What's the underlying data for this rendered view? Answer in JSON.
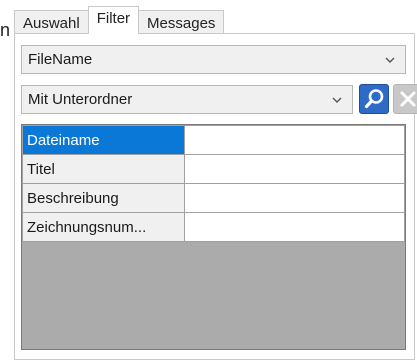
{
  "side_letter": "n",
  "tabs": [
    {
      "label": "Auswahl",
      "active": false
    },
    {
      "label": "Filter",
      "active": true
    },
    {
      "label": "Messages",
      "active": false
    }
  ],
  "filter": {
    "field_combo": {
      "value": "FileName"
    },
    "scope_combo": {
      "value": "Mit Unterordner"
    },
    "search_button": {
      "icon": "search-icon"
    },
    "clear_button": {
      "icon": "close-icon"
    }
  },
  "grid": {
    "rows": [
      {
        "name": "Dateiname",
        "value": "",
        "selected": true
      },
      {
        "name": "Titel",
        "value": "",
        "selected": false
      },
      {
        "name": "Beschreibung",
        "value": "",
        "selected": false
      },
      {
        "name": "Zeichnungsnum...",
        "value": "",
        "selected": false
      }
    ]
  },
  "colors": {
    "selection": "#0a78d7",
    "search_button": "#2e6bc6",
    "grid_background": "#ababab"
  }
}
